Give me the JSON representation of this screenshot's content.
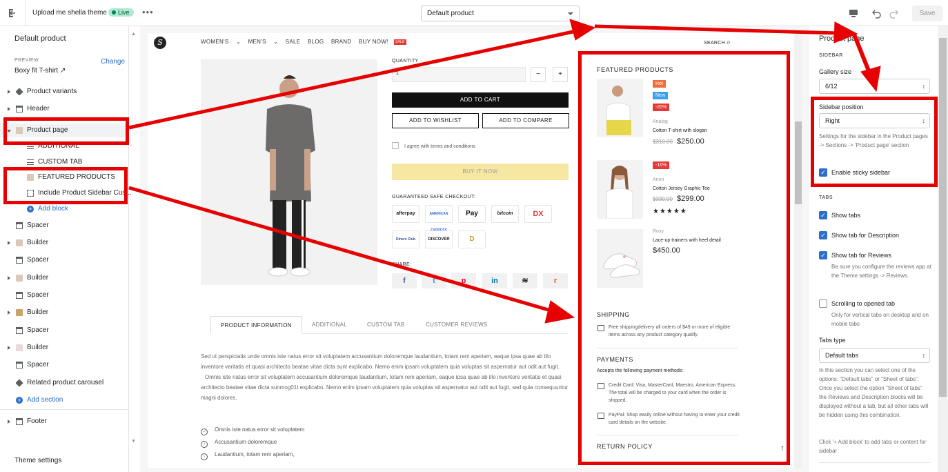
{
  "topbar": {
    "theme_name": "Upload me shella theme",
    "live_badge": "Live",
    "more": "•••",
    "template_select": "Default product",
    "save_label": "Save"
  },
  "left_panel": {
    "title": "Default product",
    "preview_label": "PREVIEW",
    "preview_change": "Change",
    "preview_product": "Boxy fit T-shirt",
    "items": [
      {
        "label": "Product variants",
        "icon": "tag-icon"
      },
      {
        "label": "Header",
        "icon": "section-icon"
      },
      {
        "label": "Product page",
        "icon": "product-thumb-icon"
      },
      {
        "label": "ADDITIONAL",
        "icon": "text-lines-icon"
      },
      {
        "label": "CUSTOM TAB",
        "icon": "text-lines-icon"
      },
      {
        "label": "FEATURED PRODUCTS",
        "icon": "product-thumb-icon"
      },
      {
        "label": "Include Product Sidebar Cus...",
        "icon": "dashed-frame-icon"
      },
      {
        "label": "Add block",
        "icon": "plus-circle-icon"
      },
      {
        "label": "Spacer",
        "icon": "section-icon"
      },
      {
        "label": "Builder",
        "icon": "image-thumb-icon"
      },
      {
        "label": "Spacer",
        "icon": "section-icon"
      },
      {
        "label": "Builder",
        "icon": "image-thumb-icon"
      },
      {
        "label": "Spacer",
        "icon": "section-icon"
      },
      {
        "label": "Builder",
        "icon": "image-thumb-icon"
      },
      {
        "label": "Spacer",
        "icon": "section-icon"
      },
      {
        "label": "Builder",
        "icon": "image-thumb-icon"
      },
      {
        "label": "Spacer",
        "icon": "section-icon"
      },
      {
        "label": "Related product carousel",
        "icon": "tag-icon"
      },
      {
        "label": "Add section",
        "icon": "plus-circle-icon"
      },
      {
        "label": "Footer",
        "icon": "section-icon"
      }
    ],
    "theme_settings": "Theme settings"
  },
  "store": {
    "nav": [
      "WOMEN'S",
      "MEN'S",
      "SALE",
      "BLOG",
      "BRAND",
      "BUY NOW!"
    ],
    "sale_tag": "SALE",
    "search": "SEARCH",
    "quantity_label": "QUANTITY",
    "quantity_value": "1",
    "add_to_cart": "ADD TO CART",
    "add_to_wishlist": "ADD TO WISHLIST",
    "add_to_compare": "ADD TO COMPARE",
    "agree_terms": "I agree with terms and conditions",
    "buy_it_now": "BUY IT NOW",
    "guaranteed": "GUARANTEED SAFE CHECKOUT:",
    "payment_logos": [
      "afterpay",
      "AMERICAN EXPRESS",
      "Pay",
      "bitcoin",
      "DX",
      "Diners Club",
      "DISCOVER",
      "D"
    ],
    "share_label": "SHARE:",
    "share_icons": [
      "f",
      "t",
      "p",
      "in",
      "≋",
      "r"
    ],
    "tabs": [
      "PRODUCT INFORMATION",
      "ADDITIONAL",
      "CUSTOM TAB",
      "CUSTOMER REVIEWS"
    ],
    "desc_p1": "Sed ut perspiciatis unde omnis iste natus error sit voluptatem accusantium doloremque laudantium, totam rem aperiam, eaque ipsa quae ab illo inventore veritatis et quasi architecto beatae vitae dicta sunt explicabo. Nemo enim ipsam voluptatem quia voluptas sit aspernatur aut odit aut fugit.",
    "desc_p2": "Omnis iste natus error sit voluptatem accusantium doloremque laudantium, totam rem aperiam, eaque ipsa quae ab illo inventore veritatis et quasi architecto beatae vitae dicta sunmog01t explicabo. Nemo enim ipsam voluptatem quia voluptas sit aspernatur aut odit aut fugit, sed quia consequuntur magni dolores.",
    "bullets": [
      "Omnis iste natus error sit voluptatem",
      "Accusantium doloremque",
      "Laudantium, totam rem aperiam,"
    ]
  },
  "sidebar_preview": {
    "featured_title": "FEATURED PRODUCTS",
    "products": [
      {
        "badges": [
          "Hot",
          "New",
          "-20%"
        ],
        "vendor": "Analog",
        "name": "Cotton T-shirt with slogan",
        "old_price": "$310.00",
        "price": "$250.00"
      },
      {
        "badges": [
          "-10%"
        ],
        "vendor": "Anon",
        "name": "Cotton Jersey Graphic Tee",
        "old_price": "$330.00",
        "price": "$299.00",
        "stars": "★★★★★"
      },
      {
        "badges": [],
        "vendor": "Roxy",
        "name": "Lace-up trainers with heel detail",
        "old_price": "",
        "price": "$450.00"
      }
    ],
    "shipping_title": "SHIPPING",
    "shipping_text": "Free shippingdelivery all orders of $49 or more of eligible items across any product category qualify.",
    "payments_title": "PAYMENTS",
    "payments_intro": "Accepts the following payment methods:",
    "payments_card": "Credit Card: Visa, MasterCard, Maestro, American Express. The total will be charged to your card when the order is shipped.",
    "payments_paypal": "PayPal: Shop easily online without having to enter your credit card details on the website.",
    "return_title": "RETURN POLICY"
  },
  "right_panel": {
    "title": "Product page",
    "sidebar_heading": "SIDEBAR",
    "gallery_label": "Gallery size",
    "gallery_value": "6/12",
    "sidebar_position_label": "Sidebar position",
    "sidebar_position_value": "Right",
    "sidebar_help": "Settings for the sidebar in the Product pages -> Sections -> 'Product page' section",
    "sticky_label": "Enable sticky sidebar",
    "tabs_heading": "TABS",
    "show_tabs": "Show tabs",
    "show_desc": "Show tab for Description",
    "show_reviews": "Show tab for Reviews",
    "reviews_help": "Be sure you configure the reviews app at the Theme settings -> Reviews.",
    "scroll_tab": "Scrolling to opened tab",
    "scroll_help": "Only for vertical tabs on desktop and on mobile tabs",
    "tabs_type_label": "Tabs type",
    "tabs_type_value": "Default tabs",
    "tabs_type_help": "In this section you can select one of the options: \"Default tabs\" or \"Sheet of tabs\". Once you select the option \"Sheet of tabs\" the Reviews and Description blocks will be displayed without a tab, but all other tabs will be hidden using this combination.",
    "add_block_help": "Click '+ Add block' to add tabs or content for sidebar"
  },
  "colors": {
    "highlight": "#e60000",
    "link": "#2c6ecb",
    "live_bg": "#aee9d1",
    "hot": "#f26b3a",
    "new": "#3aa0f2",
    "discount": "#e53935"
  }
}
